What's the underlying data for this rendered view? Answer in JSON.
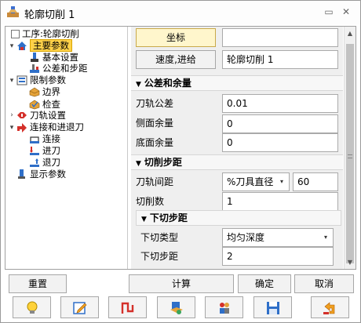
{
  "window": {
    "title": "轮廓切削 1",
    "restore_glyph": "▭",
    "close_glyph": "✕"
  },
  "tree": {
    "root_label": "工序:轮廓切削",
    "items": [
      {
        "label": "主要参数",
        "icon": "main-params-icon",
        "selected": true
      },
      {
        "label": "基本设置",
        "icon": "basic-settings-icon"
      },
      {
        "label": "公差和步距",
        "icon": "tolerance-step-icon"
      },
      {
        "label": "限制参数",
        "icon": "limit-params-icon"
      },
      {
        "label": "边界",
        "icon": "boundary-icon"
      },
      {
        "label": "检查",
        "icon": "check-icon"
      },
      {
        "label": "刀轨设置",
        "icon": "toolpath-settings-icon"
      },
      {
        "label": "连接和进退刀",
        "icon": "link-approach-icon"
      },
      {
        "label": "连接",
        "icon": "link-icon"
      },
      {
        "label": "进刀",
        "icon": "approach-icon"
      },
      {
        "label": "退刀",
        "icon": "retract-icon"
      },
      {
        "label": "显示参数",
        "icon": "display-params-icon"
      }
    ]
  },
  "props": {
    "coords_button": "坐标",
    "coords_value": "",
    "speed_button": "速度,进给",
    "speed_value": "轮廓切削 1",
    "tolerance_section": "公差和余量",
    "toolpath_tolerance_label": "刀轨公差",
    "toolpath_tolerance_value": "0.01",
    "side_allowance_label": "侧面余量",
    "side_allowance_value": "0",
    "bottom_allowance_label": "底面余量",
    "bottom_allowance_value": "0",
    "stepover_section": "切削步距",
    "path_spacing_label": "刀轨间距",
    "path_spacing_mode": "%刀具直径",
    "path_spacing_value": "60",
    "cut_count_label": "切削数",
    "cut_count_value": "1",
    "stepdown_section": "下切步距",
    "stepdown_type_label": "下切类型",
    "stepdown_type_value": "均匀深度",
    "stepdown_distance_label": "下切步距",
    "stepdown_distance_value": "2"
  },
  "buttons": {
    "reset": "重置",
    "calculate": "计算",
    "ok": "确定",
    "cancel": "取消"
  },
  "toolbar_icons": [
    "bulb-icon",
    "edit-icon",
    "toolpath-icon",
    "simulate-icon",
    "people-icon",
    "save-icon",
    "undo-icon"
  ],
  "colors": {
    "selection": "#ffd24a",
    "accent_red": "#d4302a",
    "accent_blue": "#2f6fc8"
  }
}
